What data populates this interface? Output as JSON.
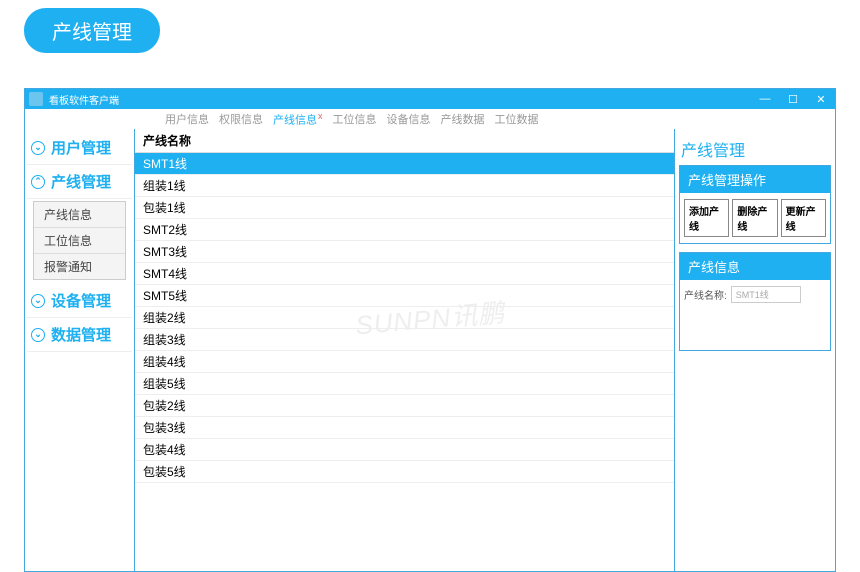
{
  "badge": "产线管理",
  "window_title": "看板软件客户端",
  "tabs": [
    {
      "label": "用户信息",
      "active": false
    },
    {
      "label": "权限信息",
      "active": false
    },
    {
      "label": "产线信息",
      "active": true,
      "closable": true
    },
    {
      "label": "工位信息",
      "active": false
    },
    {
      "label": "设备信息",
      "active": false
    },
    {
      "label": "产线数据",
      "active": false
    },
    {
      "label": "工位数据",
      "active": false
    }
  ],
  "sidebar": [
    {
      "label": "用户管理",
      "expanded": false
    },
    {
      "label": "产线管理",
      "expanded": true,
      "items": [
        "产线信息",
        "工位信息",
        "报警通知"
      ]
    },
    {
      "label": "设备管理",
      "expanded": false
    },
    {
      "label": "数据管理",
      "expanded": false
    }
  ],
  "grid": {
    "header": "产线名称",
    "rows": [
      "SMT1线",
      "组装1线",
      "包装1线",
      "SMT2线",
      "SMT3线",
      "SMT4线",
      "SMT5线",
      "组装2线",
      "组装3线",
      "组装4线",
      "组装5线",
      "包装2线",
      "包装3线",
      "包装4线",
      "包装5线"
    ],
    "selected_index": 0
  },
  "right": {
    "title": "产线管理",
    "ops_header": "产线管理操作",
    "buttons": [
      "添加产线",
      "删除产线",
      "更新产线"
    ],
    "info_header": "产线信息",
    "info_label": "产线名称:",
    "info_value": "SMT1线"
  },
  "watermark": "SUNPN讯鹏",
  "win_controls": {
    "min": "—",
    "max": "☐",
    "close": "✕"
  }
}
